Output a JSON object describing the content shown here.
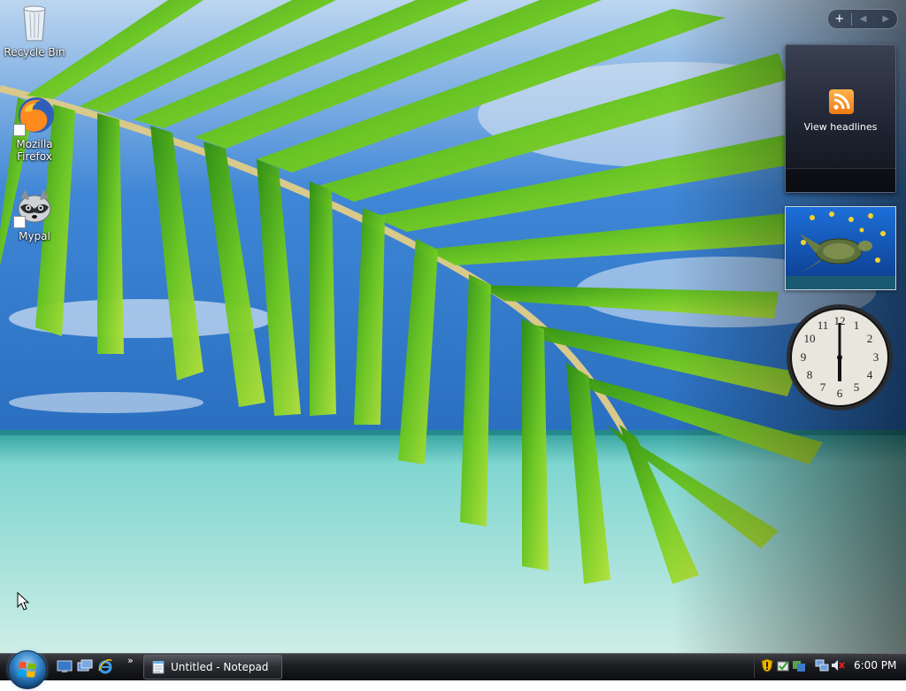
{
  "desktop": {
    "icons": [
      {
        "label": "Recycle Bin"
      },
      {
        "label": "Mozilla Firefox"
      },
      {
        "label": "Mypal"
      }
    ]
  },
  "sidebar": {
    "controls": {
      "add": "+",
      "prev": "◀",
      "next": "▶"
    },
    "feed_gadget": {
      "label": "View headlines"
    },
    "clock_gadget": {
      "time": "6:00"
    }
  },
  "taskbar": {
    "quick_launch": [
      "show-desktop-icon",
      "switch-windows-icon",
      "internet-explorer-icon"
    ],
    "quick_launch_more": "»",
    "windows": [
      {
        "title": "Untitled - Notepad"
      }
    ],
    "tray": {
      "icons": [
        "shield-warning-icon",
        "tray-app-icon",
        "tray-app-icon-2",
        "network-icon",
        "volume-muted-icon"
      ],
      "clock": "6:00 PM"
    }
  },
  "colors": {
    "sky": "#3a7fcf",
    "sea": "#7fd3cf",
    "leaf": "#5fc01e",
    "taskbar": "#1c1d21"
  }
}
